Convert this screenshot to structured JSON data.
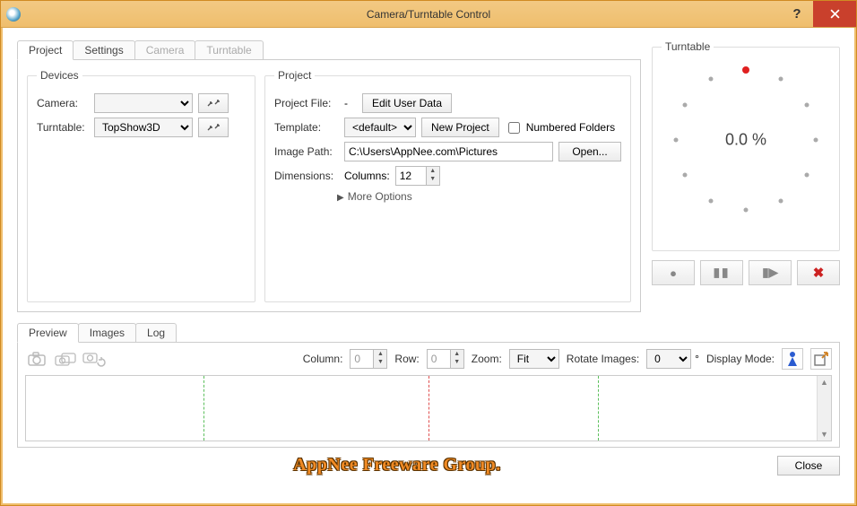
{
  "window": {
    "title": "Camera/Turntable Control"
  },
  "mainTabs": {
    "project": "Project",
    "settings": "Settings",
    "camera": "Camera",
    "turntable": "Turntable"
  },
  "devices": {
    "legend": "Devices",
    "cameraLabel": "Camera:",
    "cameraValue": "",
    "turntableLabel": "Turntable:",
    "turntableValue": "TopShow3D"
  },
  "project": {
    "legend": "Project",
    "fileLabel": "Project File:",
    "fileValue": "-",
    "editUserData": "Edit User Data",
    "templateLabel": "Template:",
    "templateValue": "<default>",
    "newProject": "New Project",
    "numberedFolders": "Numbered Folders",
    "imagePathLabel": "Image Path:",
    "imagePathValue": "C:\\Users\\AppNee.com\\Pictures",
    "openBtn": "Open...",
    "dimensionsLabel": "Dimensions:",
    "columnsLabel": "Columns:",
    "columnsValue": "12",
    "moreOptions": "More Options"
  },
  "turntablePanel": {
    "legend": "Turntable",
    "percent": "0.0 %"
  },
  "lowerTabs": {
    "preview": "Preview",
    "images": "Images",
    "log": "Log"
  },
  "previewToolbar": {
    "columnLabel": "Column:",
    "columnValue": "0",
    "rowLabel": "Row:",
    "rowValue": "0",
    "zoomLabel": "Zoom:",
    "zoomValue": "Fit",
    "rotateLabel": "Rotate Images:",
    "rotateValue": "0",
    "displayModeLabel": "Display Mode:"
  },
  "footer": {
    "watermark": "AppNee Freeware Group.",
    "close": "Close"
  }
}
